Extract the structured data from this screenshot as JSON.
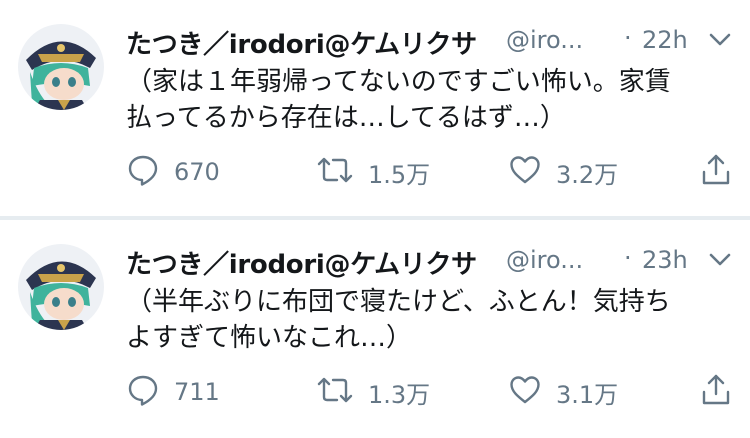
{
  "tweets": [
    {
      "display_name": "たつき／irodori@ケムリクサ",
      "handle": "@iro...",
      "separator": "·",
      "time": "22h",
      "text_lines": [
        "（家は１年弱帰ってないのですごい怖い。家賃",
        "払ってるから存在は…してるはず…）"
      ],
      "replies": "670",
      "retweets": "1.5万",
      "likes": "3.2万"
    },
    {
      "display_name": "たつき／irodori@ケムリクサ",
      "handle": "@iro...",
      "separator": "·",
      "time": "23h",
      "text_lines": [
        "（半年ぶりに布団で寝たけど、ふとん！気持ち",
        "よすぎて怖いなこれ…）"
      ],
      "replies": "711",
      "retweets": "1.3万",
      "likes": "3.1万"
    }
  ],
  "colors": {
    "text_primary": "#14171a",
    "text_secondary": "#657786",
    "divider": "#e6ecf0"
  },
  "icons": {
    "reply": "speech-bubble-icon",
    "retweet": "retweet-arrows-icon",
    "like": "heart-icon",
    "share": "share-upload-icon",
    "menu": "chevron-down-icon"
  }
}
